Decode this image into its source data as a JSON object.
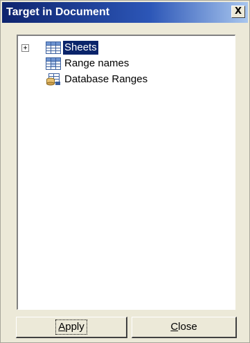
{
  "window": {
    "title": "Target in Document",
    "close_glyph": "X"
  },
  "tree": {
    "items": [
      {
        "label": "Sheets",
        "icon": "sheet-grid-icon",
        "expander": "+",
        "selected": true
      },
      {
        "label": "Range names",
        "icon": "range-grid-icon",
        "selected": false
      },
      {
        "label": "Database Ranges",
        "icon": "database-ranges-icon",
        "selected": false
      }
    ]
  },
  "buttons": {
    "apply": {
      "accel": "A",
      "rest": "pply"
    },
    "close": {
      "accel": "C",
      "rest": "lose"
    }
  },
  "colors": {
    "selection_bg": "#0a246a",
    "titlebar_start": "#0e246e",
    "titlebar_end": "#a8c6ee",
    "dialog_bg": "#ece9d8"
  }
}
